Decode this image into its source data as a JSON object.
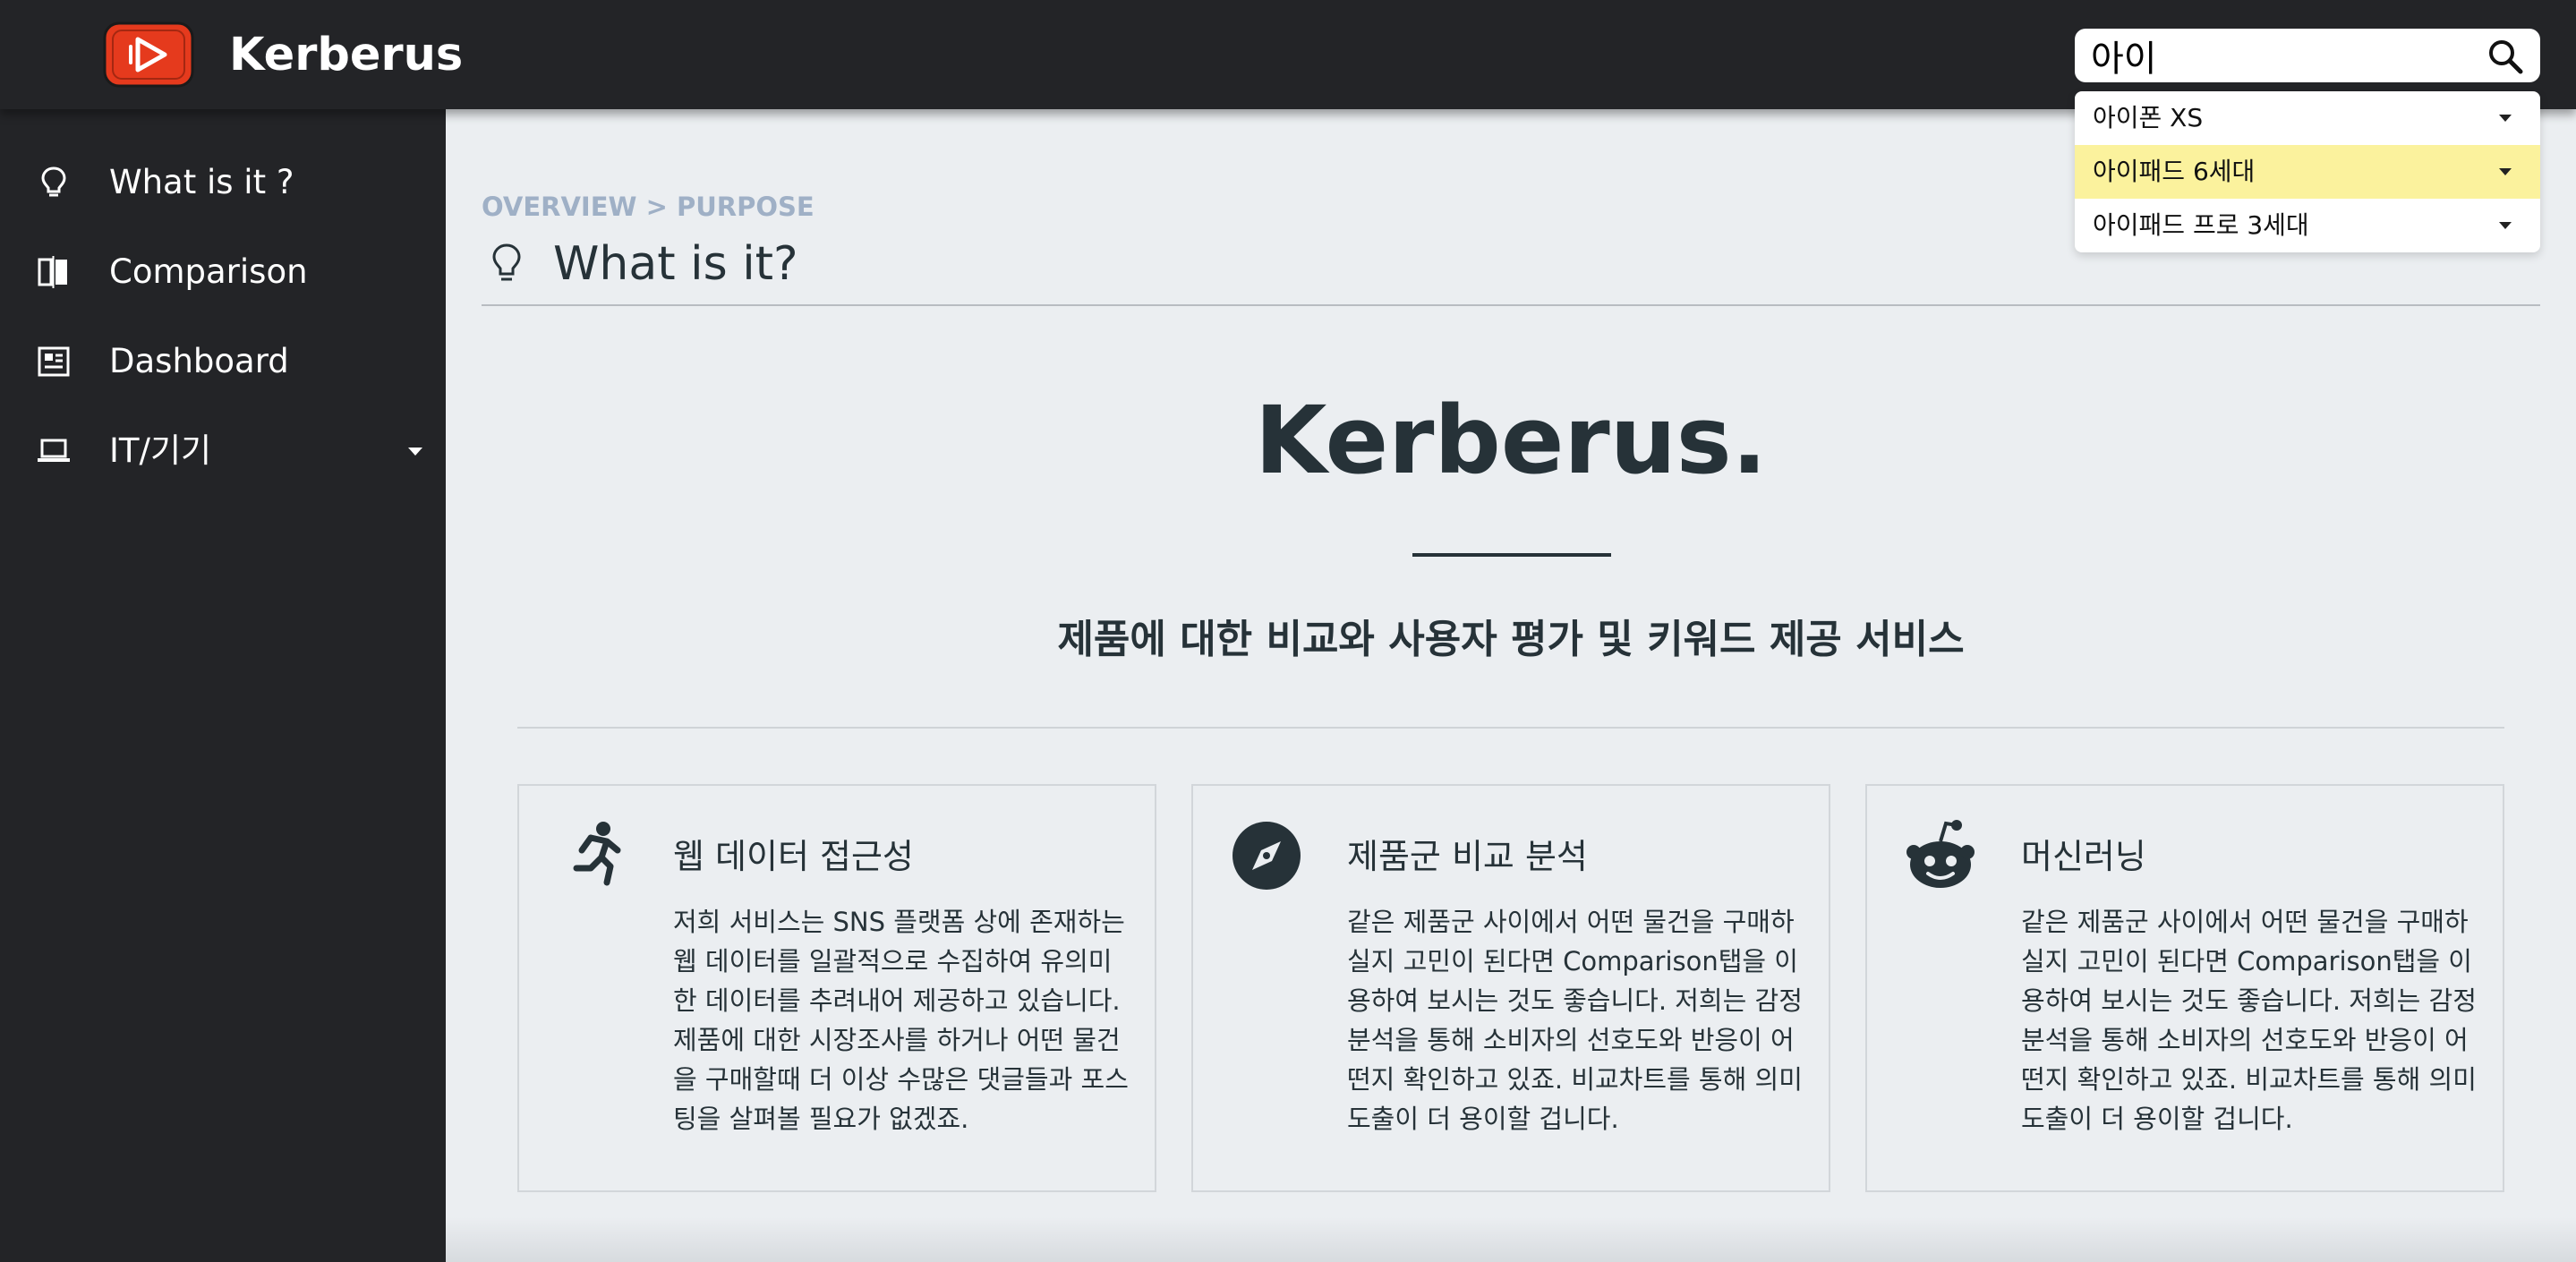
{
  "app": {
    "brand": "Kerberus",
    "accent": "#e53a1d"
  },
  "search": {
    "value": "아이",
    "suggestions": [
      {
        "label": "아이폰 XS",
        "highlighted": false
      },
      {
        "label": "아이패드 6세대",
        "highlighted": true
      },
      {
        "label": "아이패드 프로 3세대",
        "highlighted": false
      }
    ],
    "highlight_color": "#fbf29d"
  },
  "sidebar": {
    "items": [
      {
        "label": "What is it ?",
        "icon": "lightbulb-icon"
      },
      {
        "label": "Comparison",
        "icon": "compare-icon"
      },
      {
        "label": "Dashboard",
        "icon": "dashboard-icon"
      },
      {
        "label": "IT/기기",
        "icon": "laptop-icon",
        "has_submenu": true
      }
    ]
  },
  "main": {
    "breadcrumb": "OVERVIEW > PURPOSE",
    "page_title": "What is it?",
    "hero_title": "Kerberus.",
    "subtitle": "제품에 대한 비교와 사용자 평가 및 키워드 제공 서비스",
    "cards": [
      {
        "icon": "running-person-icon",
        "title": "웹 데이터 접근성",
        "text": "저희 서비스는 SNS 플랫폼 상에 존재하는 웹 데이터를 일괄적으로 수집하여 유의미한 데이터를 추려내어 제공하고 있습니다. 제품에 대한 시장조사를 하거나 어떤 물건을 구매할때 더 이상 수많은 댓글들과 포스팅을 살펴볼 필요가 없겠죠."
      },
      {
        "icon": "compass-icon",
        "title": "제품군 비교 분석",
        "text": "같은 제품군 사이에서 어떤 물건을 구매하실지 고민이 된다면 Comparison탭을 이용하여 보시는 것도 좋습니다. 저희는 감정분석을 통해 소비자의 선호도와 반응이 어떤지 확인하고 있죠. 비교차트를 통해 의미 도출이 더 용이할 겁니다."
      },
      {
        "icon": "robot-icon",
        "title": "머신러닝",
        "text": "같은 제품군 사이에서 어떤 물건을 구매하실지 고민이 된다면 Comparison탭을 이용하여 보시는 것도 좋습니다. 저희는 감정분석을 통해 소비자의 선호도와 반응이 어떤지 확인하고 있죠. 비교차트를 통해 의미 도출이 더 용이할 겁니다."
      }
    ]
  }
}
